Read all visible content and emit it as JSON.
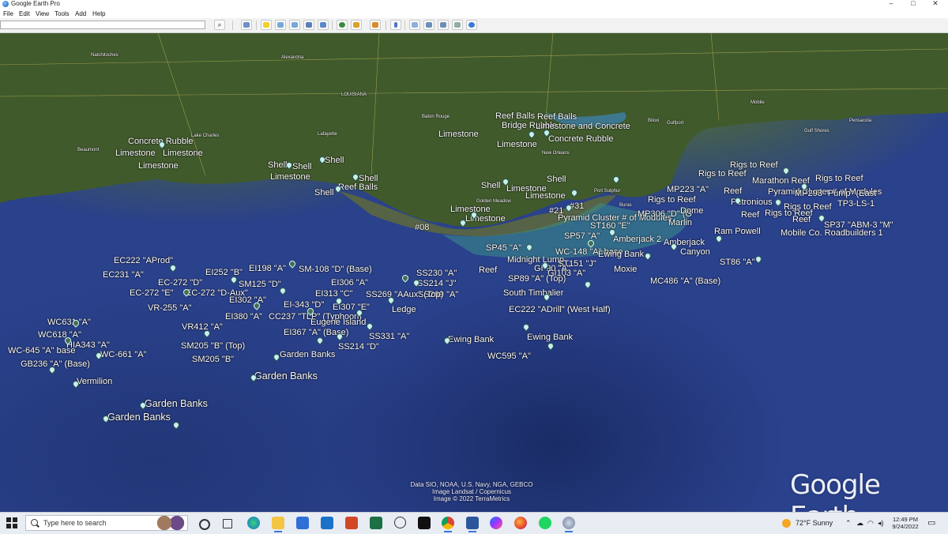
{
  "window": {
    "title": "Google Earth Pro"
  },
  "menu": [
    "File",
    "Edit",
    "View",
    "Tools",
    "Add",
    "Help"
  ],
  "search": {
    "placeholder": ""
  },
  "toolbar_icons": [
    "search-icon",
    "sidebar-toggle-icon",
    "placemark-icon",
    "polygon-icon",
    "path-icon",
    "image-overlay-icon",
    "record-tour-icon",
    "historical-imagery-icon",
    "sunlight-icon",
    "planets-icon",
    "ruler-icon",
    "email-icon",
    "print-icon",
    "save-image-icon",
    "view-in-maps-icon",
    "earth-icon"
  ],
  "map_labels": {
    "places": [
      "Natchitoches",
      "Alexandria",
      "Lake Charles",
      "Beaumont",
      "Lafayette",
      "Baton Rouge",
      "New Orleans",
      "Biloxi",
      "Gulfport",
      "Mobile",
      "Pensacola",
      "Gulf Shores",
      "Port Sulphur",
      "Buras",
      "Golden Meadow",
      "LOUISIANA"
    ],
    "placemarks": [
      "Concrete Rubble",
      "Limestone",
      "Limestone",
      "Limestone",
      "Shell",
      "Shell",
      "Limestone",
      "Shell",
      "Shell",
      "Shell",
      "Reef Balls",
      "Reef Balls",
      "Bridge Rubble",
      "Reef Balls",
      "Limestone and Concrete",
      "Limestone",
      "Limestone",
      "Concrete Rubble",
      "Shell",
      "Shell",
      "Limestone",
      "Limestone",
      "Limestone",
      "Limestone",
      "#08",
      "#21",
      "#31",
      "Pyramid Cluster # of Modules",
      "Rigs to Reef",
      "Rigs to Reef",
      "Marathon Reef",
      "Rigs to Reef",
      "MP223 \"A\"",
      "Reef",
      "Pyramid Cluster # of Modules",
      "MP293 \"Pump\" (East",
      "Rigs to Reef",
      "Petronious",
      "TP3-LS-1",
      "MP306 \"D\" (G",
      "Dome",
      "Reef",
      "Rigs to Reef",
      "Rigs to Reef",
      "Marlin",
      "Reef",
      "Ram Powell",
      "Mobile Co. Roadbuilders 1",
      "SP37 \"ABM-3 \"M\"",
      "ST160 \"E\"",
      "SP57 \"A\"",
      "Amberjack 2",
      "Amberjack",
      "Canyon",
      "ST86 \"A\"",
      "SP45 \"A\"",
      "WC-148 \"A\" base",
      "Ewing Bank",
      "Midnight Lump",
      "ST151 \"J\"",
      "Reef",
      "GI-90 \"A\"",
      "GI103 \"A\"",
      "SP89 \"A\" (Top)",
      "Moxie",
      "MC486 \"A\" (Base)",
      "South Timbalier",
      "EC222 \"ADrill\" (West Half)",
      "EC222 \"AProd\"",
      "EC231 \"A\"",
      "EC-272 \"D\"",
      "EC-272 \"E\"",
      "EC-272 \"D-Aux\"",
      "VR-255 \"A\"",
      "EI252 \"B\"",
      "EI198 \"A\"",
      "SM-108 \"D\" (Base)",
      "SM125 \"D\"",
      "EI302 \"A\"",
      "EI306 \"A\"",
      "EI313 \"C\"",
      "EI-343 \"D\"",
      "EI307 \"E\"",
      "EI380 \"A\"",
      "CC237 \"TLP\" (Typhoon)",
      "Eugene Island",
      "EI367 \"A\" (Base)",
      "SS331 \"A\"",
      "SS214 \"D\"",
      "SS230 \"A\"",
      "SS214 \"J\"",
      "SS269 \"A\"",
      "SS269 \"AAux\" (Top)",
      "Ledge",
      "Ewing Bank",
      "Ewing Bank",
      "WC595 \"A\"",
      "WC631 \"A\"",
      "WC618 \"A\"",
      "HIA343 \"A\"",
      "WC-645 \"A\" base",
      "WC-661 \"A\"",
      "GB236 \"A\" (Base)",
      "Vermilion",
      "VR412 \"A\"",
      "SM205 \"B\" (Top)",
      "SM205 \"B\"",
      "Garden Banks",
      "Garden Banks",
      "Garden Banks",
      "Garden Banks"
    ]
  },
  "credits": [
    "Data SIO, NOAA, U.S. Navy, NGA, GEBCO",
    "Image Landsat / Copernicus",
    "Image © 2022 TerraMetrics"
  ],
  "logo": "Google Earth",
  "taskbar": {
    "search_placeholder": "Type here to search",
    "apps": [
      "cortana-icon",
      "task-view-icon",
      "edge-icon",
      "file-explorer-icon",
      "store-icon",
      "mail-icon",
      "powerpoint-icon",
      "excel-icon",
      "dell-icon",
      "amazon-icon",
      "chrome-icon",
      "word-icon",
      "messenger-icon",
      "firefox-icon",
      "spotify-icon",
      "google-earth-icon"
    ],
    "weather": "72°F  Sunny",
    "time": "12:49 PM",
    "date": "9/24/2022"
  }
}
